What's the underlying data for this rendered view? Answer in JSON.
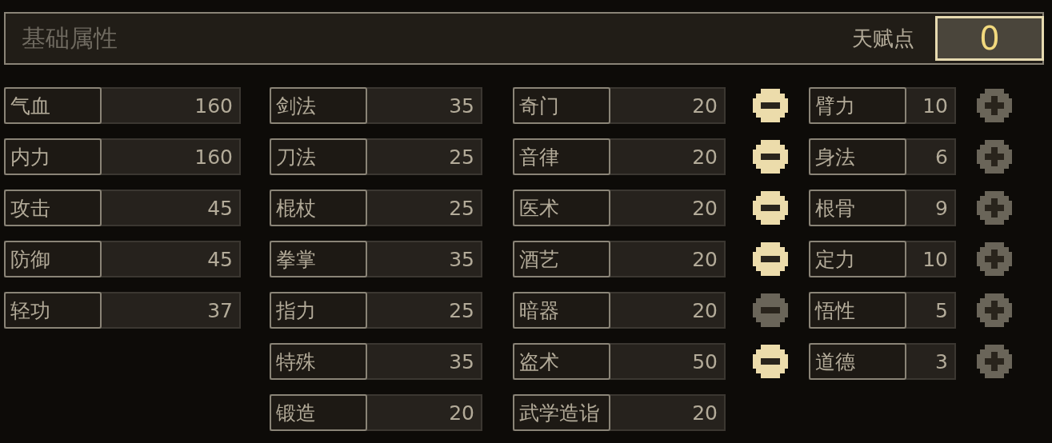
{
  "header": {
    "title": "基础属性",
    "points_label": "天赋点",
    "points_value": "0"
  },
  "stat_columns": [
    [
      {
        "label": "气血",
        "value": "160"
      },
      {
        "label": "内力",
        "value": "160"
      },
      {
        "label": "攻击",
        "value": "45"
      },
      {
        "label": "防御",
        "value": "45"
      },
      {
        "label": "轻功",
        "value": "37"
      }
    ],
    [
      {
        "label": "剑法",
        "value": "35"
      },
      {
        "label": "刀法",
        "value": "25"
      },
      {
        "label": "棍杖",
        "value": "25"
      },
      {
        "label": "拳掌",
        "value": "35"
      },
      {
        "label": "指力",
        "value": "25"
      },
      {
        "label": "特殊",
        "value": "35"
      },
      {
        "label": "锻造",
        "value": "20"
      }
    ],
    [
      {
        "label": "奇门",
        "value": "20"
      },
      {
        "label": "音律",
        "value": "20"
      },
      {
        "label": "医术",
        "value": "20"
      },
      {
        "label": "酒艺",
        "value": "20"
      },
      {
        "label": "暗器",
        "value": "20"
      },
      {
        "label": "盗术",
        "value": "50"
      },
      {
        "label": "武学造诣",
        "value": "20"
      }
    ]
  ],
  "attributes": [
    {
      "label": "臂力",
      "value": "10",
      "minus_disabled": false,
      "plus_disabled": true
    },
    {
      "label": "身法",
      "value": "6",
      "minus_disabled": false,
      "plus_disabled": true
    },
    {
      "label": "根骨",
      "value": "9",
      "minus_disabled": false,
      "plus_disabled": true
    },
    {
      "label": "定力",
      "value": "10",
      "minus_disabled": false,
      "plus_disabled": true
    },
    {
      "label": "悟性",
      "value": "5",
      "minus_disabled": true,
      "plus_disabled": true
    },
    {
      "label": "道德",
      "value": "3",
      "minus_disabled": false,
      "plus_disabled": true
    }
  ]
}
